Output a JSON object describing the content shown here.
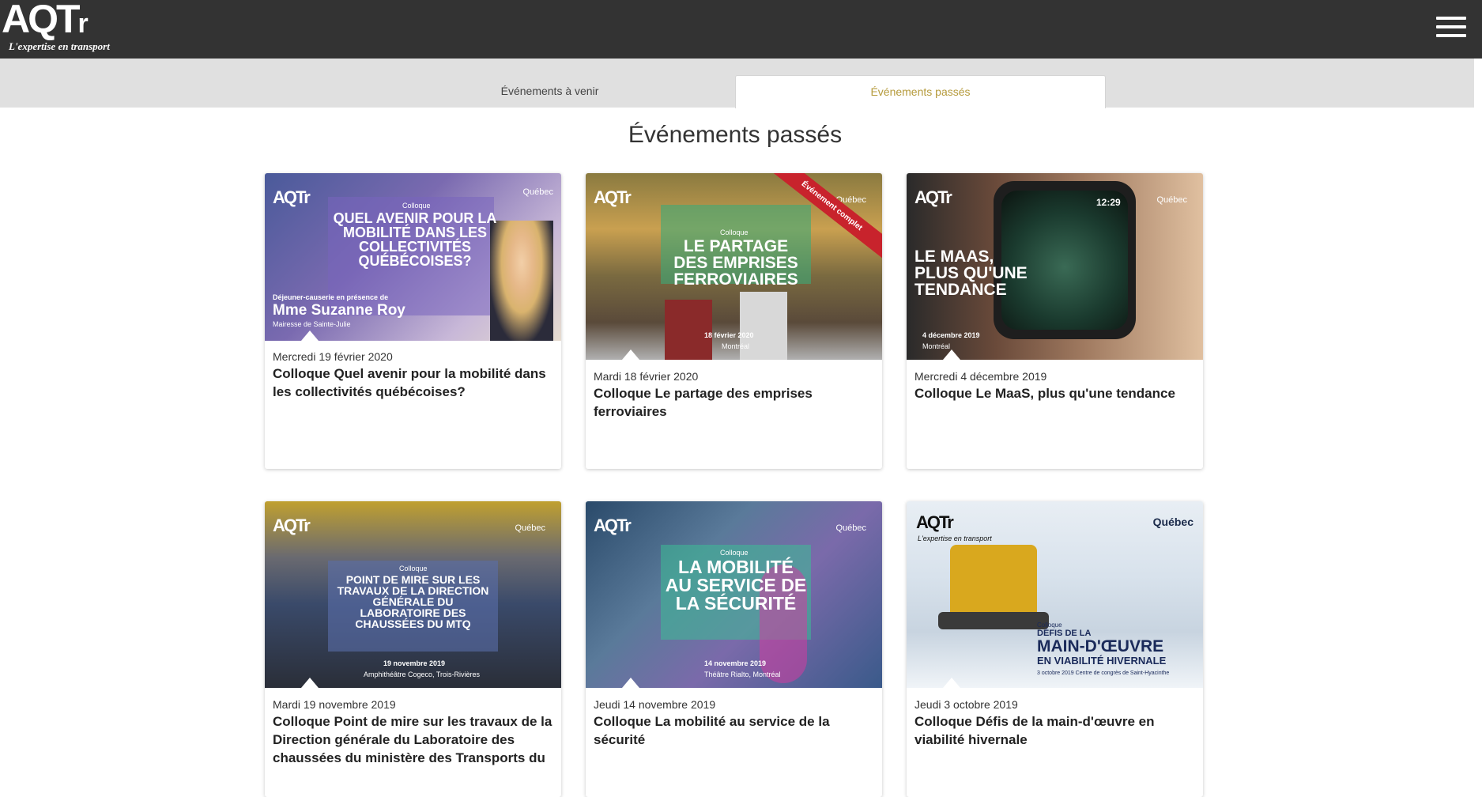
{
  "header": {
    "logo_text": "AQTr",
    "logo_tagline": "L'expertise en transport"
  },
  "tabs": {
    "upcoming": "Événements à venir",
    "past": "Événements passés"
  },
  "page_title": "Événements passés",
  "cards": [
    {
      "date": "Mercredi 19 février 2020",
      "title": "Colloque Quel avenir pour la mobilité dans les collectivités québécoises?",
      "image": {
        "small": "Colloque",
        "heading": "Quel avenir pour la mobilité dans les collectivités québécoises?",
        "guest_intro": "Déjeuner-causerie en présence de",
        "guest_name": "Mme Suzanne Roy",
        "guest_role": "Mairesse de Sainte-Julie"
      }
    },
    {
      "date": "Mardi 18 février 2020",
      "title": "Colloque Le partage des emprises ferroviaires",
      "image": {
        "small": "Colloque",
        "heading": "Le partage des emprises ferroviaires",
        "event_date": "18 février 2020",
        "place": "Montréal",
        "ribbon": "Événement complet"
      }
    },
    {
      "date": "Mercredi 4 décembre 2019",
      "title": "Colloque Le MaaS, plus qu'une tendance",
      "image": {
        "heading": "Le MaaS, plus qu'une tendance",
        "event_date": "4 décembre 2019",
        "place": "Montréal",
        "clock": "12:29"
      }
    },
    {
      "date": "Mardi 19 novembre 2019",
      "title": "Colloque Point de mire sur les travaux de la Direction générale du Laboratoire des chaussées du ministère des Transports du",
      "image": {
        "small": "Colloque",
        "heading": "Point de mire sur les travaux de la direction générale du laboratoire des chaussées du MTQ",
        "event_date": "19 novembre 2019",
        "place": "Amphithéâtre Cogeco, Trois-Rivières"
      }
    },
    {
      "date": "Jeudi 14 novembre 2019",
      "title": "Colloque La mobilité au service de la sécurité",
      "image": {
        "small": "Colloque",
        "heading": "La mobilité au service de la sécurité",
        "event_date": "14 novembre 2019",
        "place": "Théâtre Rialto, Montréal"
      }
    },
    {
      "date": "Jeudi 3 octobre 2019",
      "title": "Colloque Défis de la main-d'œuvre en viabilité hivernale",
      "image": {
        "small": "Colloque",
        "heading_top": "Défis de la",
        "heading_main": "Main-d'œuvre",
        "heading_bottom": "en viabilité hivernale",
        "footer": "3 octobre 2019  Centre de congrès de Saint-Hyacinthe"
      }
    }
  ],
  "image_brand": {
    "logo": "AQTr",
    "tagline": "L'expertise en transport",
    "partner": "Québec"
  }
}
